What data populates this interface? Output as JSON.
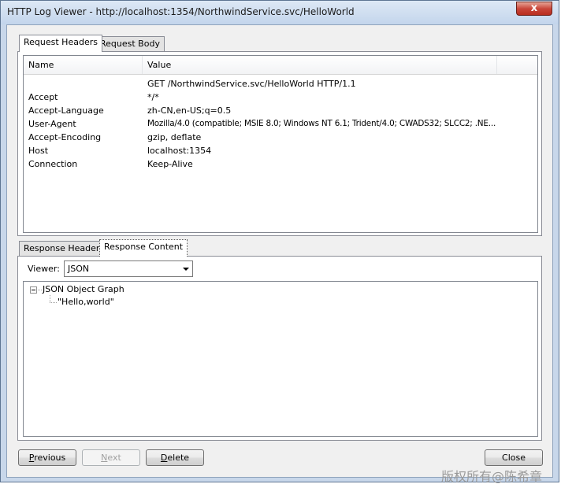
{
  "window": {
    "title": "HTTP Log Viewer - http://localhost:1354/NorthwindService.svc/HelloWorld",
    "close_glyph": "x"
  },
  "request": {
    "tabs": [
      {
        "label": "Request Headers",
        "active": true
      },
      {
        "label": "Request Body",
        "active": false
      }
    ],
    "columns": [
      "Name",
      "Value"
    ],
    "rows": [
      {
        "name": "",
        "value": "GET /NorthwindService.svc/HelloWorld HTTP/1.1"
      },
      {
        "name": "Accept",
        "value": "*/*"
      },
      {
        "name": "Accept-Language",
        "value": "zh-CN,en-US;q=0.5"
      },
      {
        "name": "User-Agent",
        "value": "Mozilla/4.0 (compatible; MSIE 8.0; Windows NT 6.1; Trident/4.0; CWADS32; SLCC2; .NE..."
      },
      {
        "name": "Accept-Encoding",
        "value": "gzip, deflate"
      },
      {
        "name": "Host",
        "value": "localhost:1354"
      },
      {
        "name": "Connection",
        "value": "Keep-Alive"
      }
    ]
  },
  "response": {
    "tabs": [
      {
        "label": "Response Headers",
        "active": false
      },
      {
        "label": "Response Content",
        "active": true
      }
    ],
    "viewer_label": "Viewer:",
    "viewer_value": "JSON",
    "tree": {
      "root": "JSON Object Graph",
      "child": "\"Hello,world\""
    }
  },
  "buttons": {
    "previous": {
      "underline": "P",
      "rest": "revious"
    },
    "next": {
      "underline": "N",
      "rest": "ext"
    },
    "delete": {
      "underline": "D",
      "rest": "elete"
    },
    "close": "Close"
  },
  "watermark": "版权所有@陈希章"
}
